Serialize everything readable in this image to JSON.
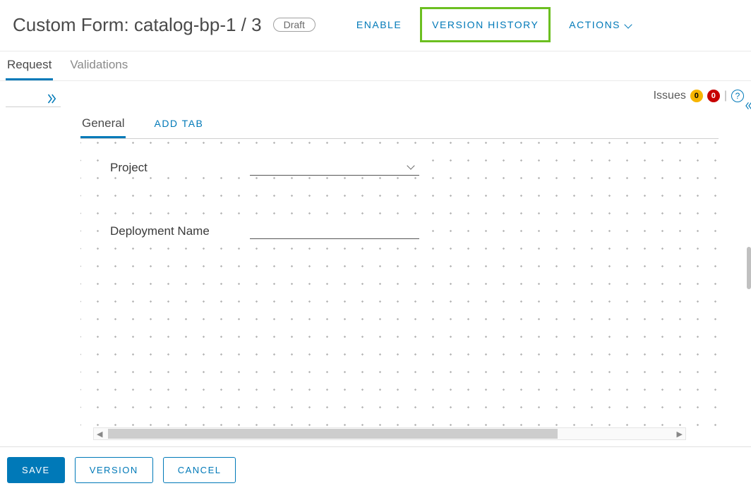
{
  "header": {
    "title": "Custom Form: catalog-bp-1 / 3",
    "status_badge": "Draft",
    "enable_label": "ENABLE",
    "version_history_label": "VERSION HISTORY",
    "actions_label": "ACTIONS"
  },
  "subtabs": {
    "request": "Request",
    "validations": "Validations"
  },
  "issues": {
    "label": "Issues",
    "warn_count": "0",
    "error_count": "0"
  },
  "inner_tabs": {
    "general": "General",
    "add_tab": "ADD TAB"
  },
  "fields": {
    "project_label": "Project",
    "deployment_label": "Deployment Name"
  },
  "footer": {
    "save": "SAVE",
    "version": "VERSION",
    "cancel": "CANCEL"
  },
  "help_glyph": "?"
}
